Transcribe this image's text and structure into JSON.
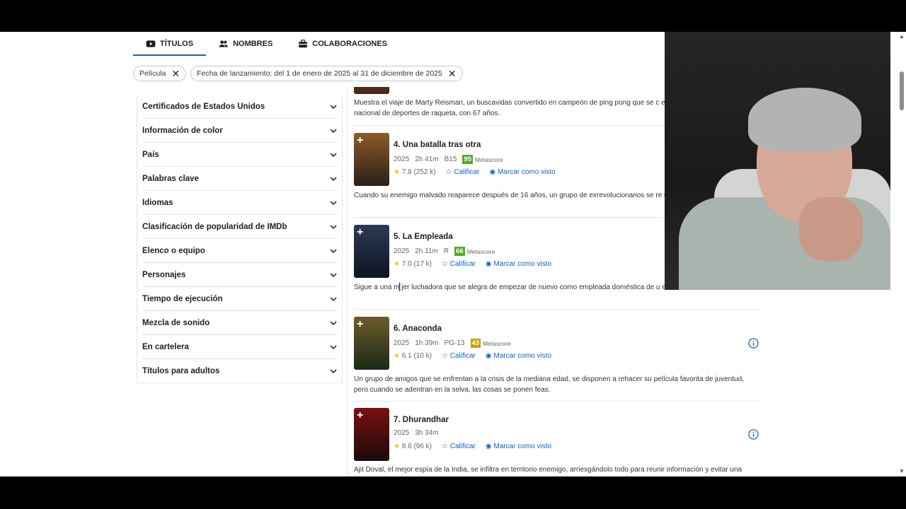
{
  "tabs": [
    {
      "label": "TÍTULOS",
      "icon": "youtube-icon",
      "active": true
    },
    {
      "label": "NOMBRES",
      "icon": "people-icon",
      "active": false
    },
    {
      "label": "COLABORACIONES",
      "icon": "briefcase-icon",
      "active": false
    }
  ],
  "chips": [
    {
      "label": "Película"
    },
    {
      "label": "Fecha de lanzamiento: del 1 de enero de 2025 al 31 de diciembre de 2025"
    }
  ],
  "facets": [
    "Certificados de Estados Unidos",
    "Información de color",
    "País",
    "Palabras clave",
    "Idiomas",
    "Clasificación de popularidad de IMDb",
    "Elenco o equipo",
    "Personajes",
    "Tiempo de ejecución",
    "Mezcla de sonido",
    "En cartelera",
    "Títulos para adultos"
  ],
  "prev_description": "Muestra el viaje de Marty Reisman, un buscavidas convertido en campeón de ping pong que se c en ganar una competición nacional de deportes de raqueta, con 67 años.",
  "labels": {
    "metascore": "Metascore",
    "rate": "Calificar",
    "watched": "Marcar como visto"
  },
  "items": [
    {
      "title": "4. Una batalla tras otra",
      "year": "2025",
      "runtime": "2h 41m",
      "cert": "B15",
      "metascore": "95",
      "ms_color": "#54a72a",
      "rating": "7.8",
      "votes": "(252 k)",
      "description": "Cuando su enemigo malvado reaparece después de 16 años, un grupo de exrevolucionarios se re uno de ellos.",
      "poster_colors": [
        "#8c5a2a",
        "#2b2018"
      ]
    },
    {
      "title": "5. La Empleada",
      "year": "2025",
      "runtime": "2h 11m",
      "cert": "R",
      "metascore": "66",
      "ms_color": "#54a72a",
      "rating": "7.0",
      "votes": "(17 k)",
      "description": "Sigue a una m jer luchadora que se alegra de empezar de nuevo como empleada doméstica de u elitista.",
      "poster_colors": [
        "#2c3a52",
        "#0e1522"
      ]
    },
    {
      "title": "6. Anaconda",
      "year": "2025",
      "runtime": "1h 39m",
      "cert": "PG-13",
      "metascore": "43",
      "ms_color": "#c8a000",
      "rating": "6.1",
      "votes": "(10 k)",
      "description": "Un grupo de amigos que se enfrentan a la crisis de la mediana edad, se disponen a rehacer su película favorita de juventud, pero cuando se adentran en la selva, las cosas se ponen feas.",
      "poster_colors": [
        "#6d5b2c",
        "#1a2a16"
      ]
    },
    {
      "title": "7. Dhurandhar",
      "year": "2025",
      "runtime": "3h 34m",
      "cert": "",
      "metascore": "",
      "ms_color": "",
      "rating": "8.6",
      "votes": "(96 k)",
      "description": "Ajit Doval, el mejor espía de la India, se infiltra en territorio enemigo, arriesgándolo todo para reunir información y evitar una",
      "poster_colors": [
        "#7a1010",
        "#1a0a0a"
      ]
    }
  ]
}
